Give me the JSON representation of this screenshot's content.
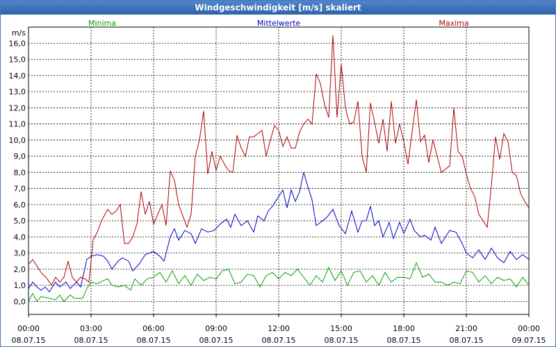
{
  "window": {
    "title": "Windgeschwindigkeit [m/s] skaliert"
  },
  "chart_data": {
    "type": "line",
    "title": "Windgeschwindigkeit [m/s] skaliert",
    "ylabel": "m/s",
    "ylim": [
      -0.8,
      17
    ],
    "yticks": [
      "0,0",
      "1,0",
      "2,0",
      "3,0",
      "4,0",
      "5,0",
      "6,0",
      "7,0",
      "8,0",
      "9,0",
      "10,0",
      "11,0",
      "12,0",
      "13,0",
      "14,0",
      "15,0",
      "16,0"
    ],
    "xlim_hours": [
      0,
      24
    ],
    "xticks": [
      {
        "time": "00:00",
        "date": "08.07.15"
      },
      {
        "time": "03:00",
        "date": "08.07.15"
      },
      {
        "time": "06:00",
        "date": "08.07.15"
      },
      {
        "time": "09:00",
        "date": "08.07.15"
      },
      {
        "time": "12:00",
        "date": "08.07.15"
      },
      {
        "time": "15:00",
        "date": "08.07.15"
      },
      {
        "time": "18:00",
        "date": "08.07.15"
      },
      {
        "time": "21:00",
        "date": "08.07.15"
      },
      {
        "time": "00:00",
        "date": "09.07.15"
      }
    ],
    "grid": true,
    "colors": {
      "Minima": "#00a000",
      "Mittelwerte": "#0000c0",
      "Maxima": "#b00000"
    },
    "series": [
      {
        "name": "Minima",
        "points": [
          [
            0,
            0
          ],
          [
            0.2,
            0.5
          ],
          [
            0.4,
            0
          ],
          [
            0.6,
            0.3
          ],
          [
            1,
            0.2
          ],
          [
            1.3,
            0.1
          ],
          [
            1.5,
            0.4
          ],
          [
            1.7,
            0
          ],
          [
            2,
            0.4
          ],
          [
            2.2,
            0.2
          ],
          [
            2.4,
            0.2
          ],
          [
            2.6,
            0.2
          ],
          [
            2.8,
            0.8
          ],
          [
            3,
            1.2
          ],
          [
            3.3,
            1.1
          ],
          [
            3.6,
            1.3
          ],
          [
            3.8,
            1.4
          ],
          [
            4,
            1.0
          ],
          [
            4.3,
            0.9
          ],
          [
            4.6,
            1.0
          ],
          [
            4.9,
            0.7
          ],
          [
            5.1,
            1.4
          ],
          [
            5.4,
            1.0
          ],
          [
            5.7,
            1.4
          ],
          [
            6,
            1.5
          ],
          [
            6.3,
            1.8
          ],
          [
            6.6,
            1.2
          ],
          [
            6.9,
            1.9
          ],
          [
            7.2,
            1.1
          ],
          [
            7.5,
            1.6
          ],
          [
            7.8,
            1.0
          ],
          [
            8.1,
            1.7
          ],
          [
            8.4,
            1.3
          ],
          [
            8.7,
            1.5
          ],
          [
            9,
            1.4
          ],
          [
            9.3,
            1.9
          ],
          [
            9.6,
            2.0
          ],
          [
            9.9,
            1.1
          ],
          [
            10.2,
            1.2
          ],
          [
            10.5,
            1.7
          ],
          [
            10.8,
            1.6
          ],
          [
            11.1,
            0.9
          ],
          [
            11.4,
            1.6
          ],
          [
            11.7,
            1.8
          ],
          [
            12,
            1.4
          ],
          [
            12.3,
            1.8
          ],
          [
            12.6,
            1.6
          ],
          [
            12.9,
            2.0
          ],
          [
            13.2,
            1.5
          ],
          [
            13.5,
            1.0
          ],
          [
            13.8,
            1.6
          ],
          [
            14.1,
            1.2
          ],
          [
            14.4,
            2.1
          ],
          [
            14.7,
            1.3
          ],
          [
            15,
            1.9
          ],
          [
            15.3,
            1.0
          ],
          [
            15.6,
            1.8
          ],
          [
            15.9,
            1.9
          ],
          [
            16.2,
            1.2
          ],
          [
            16.5,
            1.6
          ],
          [
            16.8,
            1.0
          ],
          [
            17.1,
            1.8
          ],
          [
            17.4,
            1.2
          ],
          [
            17.7,
            1.5
          ],
          [
            18,
            1.5
          ],
          [
            18.3,
            1.4
          ],
          [
            18.6,
            2.4
          ],
          [
            18.9,
            1.5
          ],
          [
            19.2,
            1.7
          ],
          [
            19.5,
            1.2
          ],
          [
            19.8,
            1.2
          ],
          [
            20.1,
            1.0
          ],
          [
            20.4,
            1.2
          ],
          [
            20.7,
            1.1
          ],
          [
            21,
            1.9
          ],
          [
            21.3,
            1.8
          ],
          [
            21.6,
            1.2
          ],
          [
            21.9,
            1.6
          ],
          [
            22.2,
            1.1
          ],
          [
            22.5,
            1.5
          ],
          [
            22.8,
            1.3
          ],
          [
            23.1,
            1.4
          ],
          [
            23.4,
            0.9
          ],
          [
            23.7,
            1.5
          ],
          [
            24,
            1.0
          ]
        ]
      },
      {
        "name": "Mittelwerte",
        "points": [
          [
            0,
            0.8
          ],
          [
            0.2,
            1.2
          ],
          [
            0.4,
            0.9
          ],
          [
            0.6,
            0.7
          ],
          [
            0.8,
            0.9
          ],
          [
            1,
            0.6
          ],
          [
            1.3,
            1.2
          ],
          [
            1.5,
            0.9
          ],
          [
            1.8,
            1.2
          ],
          [
            2,
            0.8
          ],
          [
            2.3,
            1.2
          ],
          [
            2.5,
            0.9
          ],
          [
            2.8,
            2.6
          ],
          [
            3,
            2.8
          ],
          [
            3.3,
            2.9
          ],
          [
            3.6,
            2.8
          ],
          [
            3.8,
            2.5
          ],
          [
            4,
            2.0
          ],
          [
            4.3,
            2.5
          ],
          [
            4.5,
            2.7
          ],
          [
            4.8,
            2.5
          ],
          [
            5,
            1.9
          ],
          [
            5.3,
            2.3
          ],
          [
            5.6,
            2.9
          ],
          [
            6,
            3.1
          ],
          [
            6.3,
            2.8
          ],
          [
            6.5,
            2.5
          ],
          [
            6.8,
            4.0
          ],
          [
            7,
            4.5
          ],
          [
            7.2,
            3.8
          ],
          [
            7.5,
            4.4
          ],
          [
            7.8,
            4.2
          ],
          [
            8,
            3.6
          ],
          [
            8.3,
            4.5
          ],
          [
            8.6,
            4.3
          ],
          [
            8.9,
            4.4
          ],
          [
            9.2,
            4.8
          ],
          [
            9.5,
            5.1
          ],
          [
            9.7,
            4.6
          ],
          [
            9.9,
            5.4
          ],
          [
            10.2,
            4.7
          ],
          [
            10.5,
            5.0
          ],
          [
            10.8,
            4.3
          ],
          [
            11,
            5.3
          ],
          [
            11.3,
            5.0
          ],
          [
            11.5,
            5.6
          ],
          [
            11.7,
            5.9
          ],
          [
            12,
            6.5
          ],
          [
            12.2,
            6.9
          ],
          [
            12.4,
            5.8
          ],
          [
            12.6,
            6.9
          ],
          [
            12.8,
            6.2
          ],
          [
            13,
            6.8
          ],
          [
            13.2,
            8.0
          ],
          [
            13.4,
            7.1
          ],
          [
            13.6,
            6.3
          ],
          [
            13.8,
            4.7
          ],
          [
            14,
            4.9
          ],
          [
            14.3,
            5.2
          ],
          [
            14.6,
            5.7
          ],
          [
            14.9,
            4.7
          ],
          [
            15.2,
            4.2
          ],
          [
            15.5,
            5.6
          ],
          [
            15.8,
            4.3
          ],
          [
            16,
            5.0
          ],
          [
            16.2,
            5.0
          ],
          [
            16.4,
            5.9
          ],
          [
            16.6,
            4.7
          ],
          [
            16.8,
            5.0
          ],
          [
            17,
            4.0
          ],
          [
            17.3,
            4.9
          ],
          [
            17.5,
            3.9
          ],
          [
            17.8,
            4.9
          ],
          [
            18,
            4.2
          ],
          [
            18.3,
            5.1
          ],
          [
            18.5,
            4.4
          ],
          [
            18.8,
            4.0
          ],
          [
            19,
            4.1
          ],
          [
            19.3,
            3.8
          ],
          [
            19.5,
            4.6
          ],
          [
            19.8,
            3.6
          ],
          [
            20,
            4.0
          ],
          [
            20.2,
            4.4
          ],
          [
            20.5,
            4.3
          ],
          [
            20.8,
            3.6
          ],
          [
            21,
            3.0
          ],
          [
            21.3,
            2.7
          ],
          [
            21.6,
            3.2
          ],
          [
            21.9,
            2.6
          ],
          [
            22.2,
            3.3
          ],
          [
            22.5,
            2.7
          ],
          [
            22.8,
            2.4
          ],
          [
            23.1,
            3.1
          ],
          [
            23.4,
            2.6
          ],
          [
            23.7,
            2.9
          ],
          [
            24,
            2.6
          ]
        ]
      },
      {
        "name": "Maxima",
        "points": [
          [
            0,
            2.3
          ],
          [
            0.2,
            2.6
          ],
          [
            0.4,
            2.2
          ],
          [
            0.6,
            1.8
          ],
          [
            0.9,
            1.4
          ],
          [
            1.1,
            1.0
          ],
          [
            1.3,
            1.5
          ],
          [
            1.5,
            1.2
          ],
          [
            1.7,
            1.5
          ],
          [
            1.9,
            2.5
          ],
          [
            2.1,
            1.5
          ],
          [
            2.3,
            1.2
          ],
          [
            2.5,
            1.5
          ],
          [
            2.7,
            1.4
          ],
          [
            2.9,
            1.2
          ],
          [
            3.1,
            3.8
          ],
          [
            3.3,
            4.3
          ],
          [
            3.5,
            5.0
          ],
          [
            3.8,
            5.7
          ],
          [
            4,
            5.4
          ],
          [
            4.2,
            5.6
          ],
          [
            4.4,
            6.0
          ],
          [
            4.6,
            3.6
          ],
          [
            4.8,
            3.6
          ],
          [
            5,
            4.0
          ],
          [
            5.2,
            4.8
          ],
          [
            5.4,
            6.8
          ],
          [
            5.6,
            5.4
          ],
          [
            5.8,
            6.2
          ],
          [
            6,
            4.8
          ],
          [
            6.2,
            5.4
          ],
          [
            6.4,
            6.0
          ],
          [
            6.6,
            4.7
          ],
          [
            6.8,
            8.1
          ],
          [
            7,
            7.5
          ],
          [
            7.2,
            6.0
          ],
          [
            7.4,
            5.3
          ],
          [
            7.6,
            4.6
          ],
          [
            7.8,
            5.4
          ],
          [
            8,
            9.0
          ],
          [
            8.2,
            10.0
          ],
          [
            8.4,
            11.8
          ],
          [
            8.6,
            7.9
          ],
          [
            8.8,
            9.3
          ],
          [
            9,
            8.1
          ],
          [
            9.2,
            9.0
          ],
          [
            9.4,
            8.5
          ],
          [
            9.6,
            8.1
          ],
          [
            9.8,
            8.0
          ],
          [
            10,
            10.3
          ],
          [
            10.2,
            9.5
          ],
          [
            10.4,
            9.0
          ],
          [
            10.6,
            10.2
          ],
          [
            10.8,
            10.2
          ],
          [
            11,
            10.4
          ],
          [
            11.2,
            10.6
          ],
          [
            11.4,
            9.0
          ],
          [
            11.6,
            10.0
          ],
          [
            11.8,
            10.9
          ],
          [
            12,
            10.6
          ],
          [
            12.2,
            9.6
          ],
          [
            12.4,
            10.2
          ],
          [
            12.6,
            9.5
          ],
          [
            12.8,
            9.5
          ],
          [
            13,
            10.5
          ],
          [
            13.2,
            11.0
          ],
          [
            13.4,
            11.3
          ],
          [
            13.6,
            11.0
          ],
          [
            13.8,
            14.1
          ],
          [
            14,
            13.5
          ],
          [
            14.2,
            12.2
          ],
          [
            14.4,
            11.4
          ],
          [
            14.6,
            16.5
          ],
          [
            14.8,
            11.4
          ],
          [
            15,
            14.7
          ],
          [
            15.2,
            12.0
          ],
          [
            15.4,
            11.0
          ],
          [
            15.6,
            11.1
          ],
          [
            15.8,
            12.4
          ],
          [
            16,
            9.0
          ],
          [
            16.2,
            8.0
          ],
          [
            16.4,
            12.3
          ],
          [
            16.6,
            11.1
          ],
          [
            16.8,
            9.8
          ],
          [
            17,
            11.3
          ],
          [
            17.2,
            9.3
          ],
          [
            17.4,
            12.4
          ],
          [
            17.6,
            9.8
          ],
          [
            17.8,
            11.0
          ],
          [
            18,
            9.9
          ],
          [
            18.2,
            8.5
          ],
          [
            18.4,
            10.5
          ],
          [
            18.6,
            12.5
          ],
          [
            18.8,
            9.9
          ],
          [
            19,
            10.3
          ],
          [
            19.2,
            8.6
          ],
          [
            19.4,
            10.0
          ],
          [
            19.6,
            9.0
          ],
          [
            19.8,
            8.0
          ],
          [
            20,
            8.2
          ],
          [
            20.2,
            8.4
          ],
          [
            20.4,
            12.0
          ],
          [
            20.6,
            9.3
          ],
          [
            20.8,
            9.0
          ],
          [
            21,
            7.9
          ],
          [
            21.2,
            7.0
          ],
          [
            21.4,
            6.5
          ],
          [
            21.6,
            5.4
          ],
          [
            21.8,
            5.0
          ],
          [
            22,
            4.6
          ],
          [
            22.2,
            7.2
          ],
          [
            22.4,
            10.2
          ],
          [
            22.6,
            8.8
          ],
          [
            22.8,
            10.4
          ],
          [
            23,
            9.9
          ],
          [
            23.2,
            8.0
          ],
          [
            23.4,
            7.8
          ],
          [
            23.6,
            6.7
          ],
          [
            23.8,
            6.2
          ],
          [
            24,
            5.8
          ]
        ]
      }
    ]
  }
}
